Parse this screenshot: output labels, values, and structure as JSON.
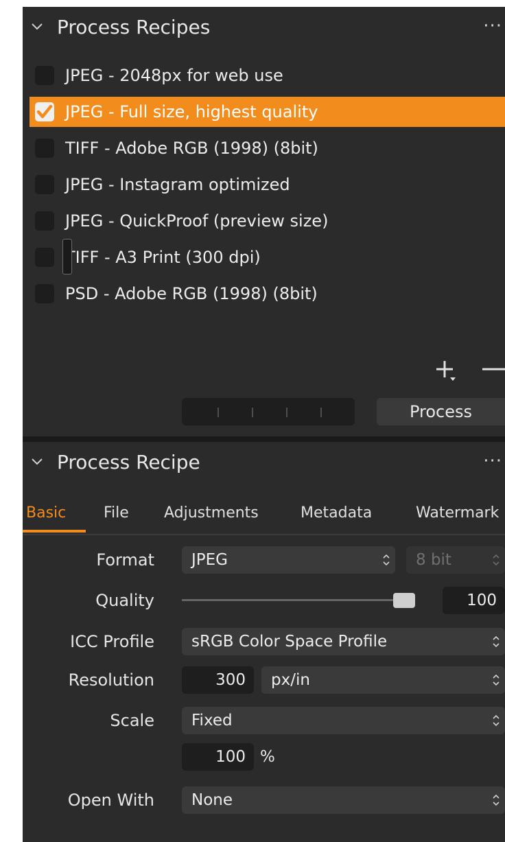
{
  "recipes_panel": {
    "title": "Process Recipes",
    "more_label": "···",
    "recipes": [
      {
        "label": "JPEG - 2048px for web use",
        "checked": false
      },
      {
        "label": "JPEG - Full size, highest quality",
        "checked": true
      },
      {
        "label": "TIFF - Adobe RGB (1998) (8bit)",
        "checked": false
      },
      {
        "label": "JPEG - Instagram optimized",
        "checked": false
      },
      {
        "label": "JPEG - QuickProof (preview size)",
        "checked": false
      },
      {
        "label": "TIFF - A3 Print (300 dpi)",
        "checked": false
      },
      {
        "label": "PSD - Adobe RGB (1998) (8bit)",
        "checked": false
      }
    ],
    "process_label": "Process"
  },
  "recipe_panel": {
    "title": "Process Recipe",
    "more_label": "···",
    "tabs": [
      {
        "label": "Basic",
        "active": true
      },
      {
        "label": "File",
        "active": false
      },
      {
        "label": "Adjustments",
        "active": false
      },
      {
        "label": "Metadata",
        "active": false
      },
      {
        "label": "Watermark",
        "active": false
      }
    ],
    "format": {
      "label": "Format",
      "value": "JPEG",
      "bit_depth": "8 bit"
    },
    "quality": {
      "label": "Quality",
      "value": "100",
      "slider_fraction": 1.0
    },
    "icc_profile": {
      "label": "ICC Profile",
      "value": "sRGB Color Space Profile"
    },
    "resolution": {
      "label": "Resolution",
      "value": "300",
      "unit": "px/in"
    },
    "scale": {
      "label": "Scale",
      "value": "Fixed",
      "percent": "100",
      "percent_unit": "%"
    },
    "open_with": {
      "label": "Open With",
      "value": "None"
    }
  },
  "colors": {
    "accent": "#f28c1d",
    "panel_bg": "#2b2b2b",
    "field_bg": "#3a3a3a"
  }
}
